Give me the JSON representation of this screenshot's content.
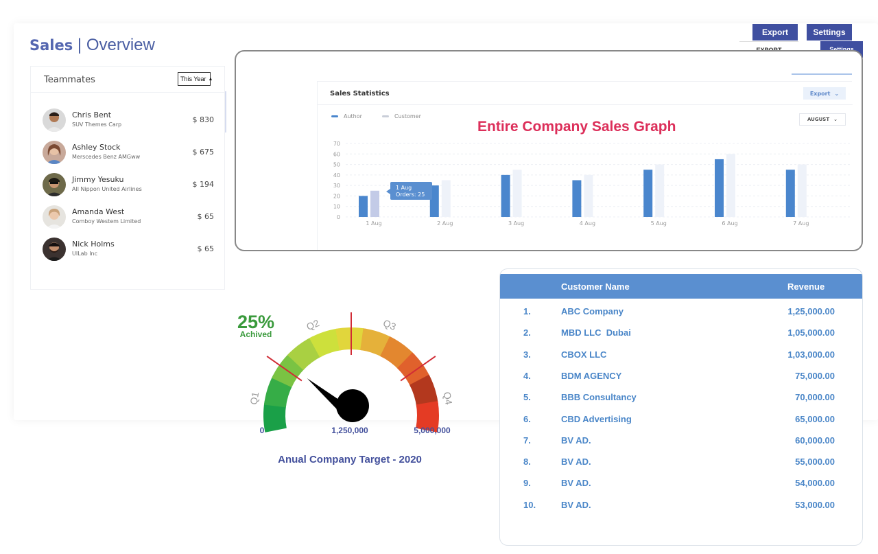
{
  "header": {
    "title_bold": "Sales",
    "title_sep": "|",
    "title_rest": "Overview",
    "export_label": "Export",
    "settings_label": "Settings",
    "ghost_export_label": "EXPORT",
    "ghost_settings_label": "Settings"
  },
  "teammates": {
    "title": "Teammates",
    "filter": "This Year",
    "members": [
      {
        "name": "Chris Bent",
        "company": "SUV Themes Carp",
        "amount": "$ 830"
      },
      {
        "name": "Ashley Stock",
        "company": "Merscedes Benz AMGww",
        "amount": "$ 675"
      },
      {
        "name": "Jimmy Yesuku",
        "company": "All Nippon United Airlines",
        "amount": "$ 194"
      },
      {
        "name": "Amanda West",
        "company": "Comboy Westem Limited",
        "amount": "$ 65"
      },
      {
        "name": "Nick Holms",
        "company": "UILab Inc",
        "amount": "$ 65"
      }
    ]
  },
  "sales_stats": {
    "title": "Sales Statistics",
    "export_label": "Export",
    "month": "AUGUST",
    "heading": "Entire Company Sales Graph",
    "tooltip_title": "1 Aug",
    "tooltip_value": "Orders: 25"
  },
  "chart_data": [
    {
      "type": "bar",
      "title": "Sales Statistics",
      "categories": [
        "1 Aug",
        "2 Aug",
        "3 Aug",
        "4 Aug",
        "5 Aug",
        "6 Aug",
        "7 Aug"
      ],
      "series": [
        {
          "name": "Author",
          "values": [
            20,
            30,
            40,
            35,
            45,
            55,
            45
          ],
          "color": "#4a86cd"
        },
        {
          "name": "Customer",
          "values": [
            25,
            35,
            45,
            40,
            50,
            60,
            50
          ],
          "color": "#eef2f9"
        }
      ],
      "yticks": [
        0,
        10,
        20,
        30,
        40,
        50,
        60,
        70
      ],
      "ylim": [
        0,
        70
      ],
      "grid": true,
      "legend": "top-left"
    }
  ],
  "gauge": {
    "percent_label": "25%",
    "achieved_label": "Achived",
    "value": 0.25,
    "quarters": [
      "Q1",
      "Q2",
      "Q3",
      "Q4"
    ],
    "min_label": "0",
    "mid_label": "1,250,000",
    "max_label": "5,000,000",
    "title": "Anual Company Target - 2020"
  },
  "customers": {
    "headers": {
      "name": "Customer Name",
      "revenue": "Revenue"
    },
    "rows": [
      {
        "num": "1.",
        "name": "ABC Company",
        "revenue": "1,25,000.00"
      },
      {
        "num": "2.",
        "name": "MBD LLC  Dubai",
        "revenue": "1,05,000.00"
      },
      {
        "num": "3.",
        "name": "CBOX LLC",
        "revenue": "1,03,000.00"
      },
      {
        "num": "4.",
        "name": "BDM AGENCY",
        "revenue": "75,000.00"
      },
      {
        "num": "5.",
        "name": "BBB Consultancy",
        "revenue": "70,000.00"
      },
      {
        "num": "6.",
        "name": "CBD Advertising",
        "revenue": "65,000.00"
      },
      {
        "num": "7.",
        "name": "BV AD.",
        "revenue": "60,000.00"
      },
      {
        "num": "8.",
        "name": "BV AD.",
        "revenue": "55,000.00"
      },
      {
        "num": "9.",
        "name": "BV AD.",
        "revenue": "54,000.00"
      },
      {
        "num": "10.",
        "name": "BV AD.",
        "revenue": "53,000.00"
      }
    ]
  },
  "colors": {
    "brand": "#3f4fa0",
    "accent_blue": "#4a86c8",
    "heading_red": "#dc2f5a",
    "gauge_green": "#3a9a3c"
  }
}
